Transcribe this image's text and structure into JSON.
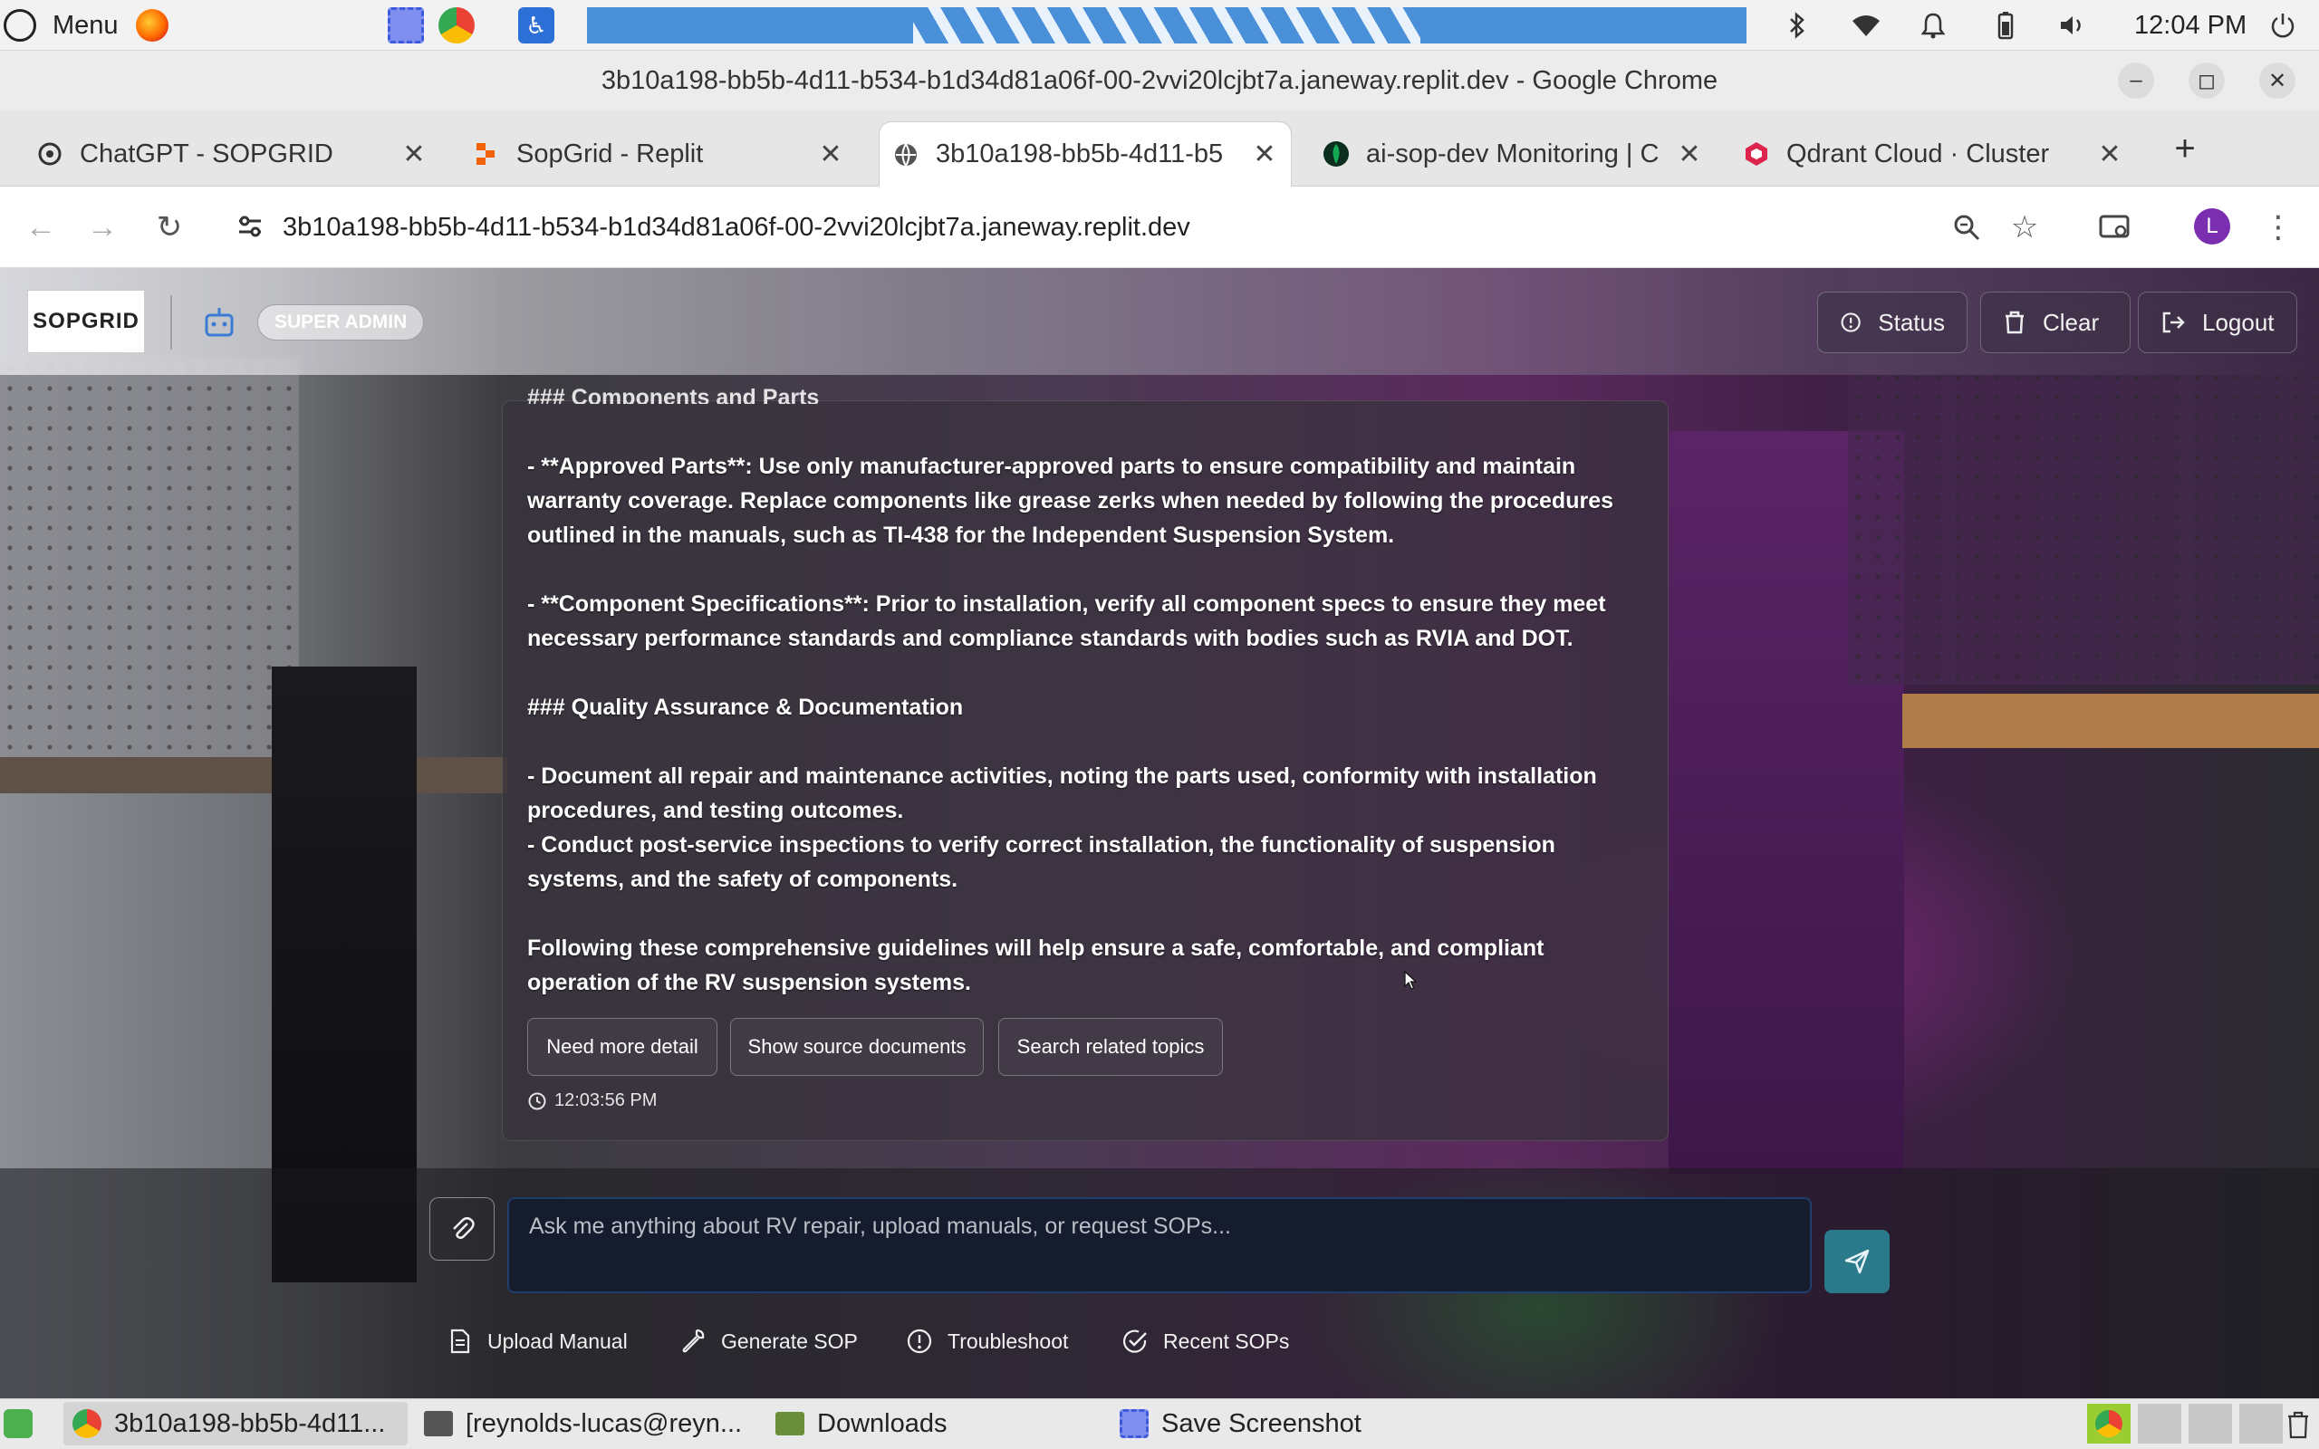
{
  "os_panel": {
    "menu_label": "Menu",
    "clock": "12:04 PM"
  },
  "browser": {
    "window_title": "3b10a198-bb5b-4d11-b534-b1d34d81a06f-00-2vvi20lcjbt7a.janeway.replit.dev - Google Chrome",
    "tabs": [
      {
        "label": "ChatGPT - SOPGRID",
        "active": false
      },
      {
        "label": "SopGrid - Replit",
        "active": false
      },
      {
        "label": "3b10a198-bb5b-4d11-b5",
        "active": true
      },
      {
        "label": "ai-sop-dev Monitoring | C",
        "active": false
      },
      {
        "label": "Qdrant Cloud · Cluster",
        "active": false
      }
    ],
    "new_tab": "+",
    "url": "3b10a198-bb5b-4d11-b534-b1d34d81a06f-00-2vvi20lcjbt7a.janeway.replit.dev",
    "profile_initial": "L"
  },
  "app": {
    "logo_text": "SOPGRID",
    "role_badge": "SUPER ADMIN",
    "header_buttons": {
      "status": "Status",
      "clear": "Clear",
      "logout": "Logout"
    },
    "message": {
      "partial_heading": "### Components and Parts",
      "approved_parts": "- **Approved Parts**: Use only manufacturer-approved parts to ensure compatibility and maintain warranty coverage. Replace components like grease zerks when needed by following the procedures outlined in the manuals, such as TI-438 for the Independent Suspension System.",
      "component_specs": "- **Component Specifications**: Prior to installation, verify all component specs to ensure they meet necessary performance standards and compliance standards with bodies such as RVIA and DOT.",
      "qa_heading": "### Quality Assurance & Documentation",
      "qa_line1": "- Document all repair and maintenance activities, noting the parts used, conformity with installation procedures, and testing outcomes.",
      "qa_line2": "- Conduct post-service inspections to verify correct installation, the functionality of suspension systems, and the safety of components.",
      "closing": "Following these comprehensive guidelines will help ensure a safe, comfortable, and compliant operation of the RV suspension systems.",
      "timestamp": "12:03:56 PM"
    },
    "followups": [
      "Need more detail",
      "Show source documents",
      "Search related topics"
    ],
    "input_placeholder": "Ask me anything about RV repair, upload manuals, or request SOPs...",
    "quick_actions": [
      "Upload Manual",
      "Generate SOP",
      "Troubleshoot",
      "Recent SOPs"
    ]
  },
  "taskbar": {
    "items": [
      "3b10a198-bb5b-4d11...",
      "[reynolds-lucas@reyn...",
      "Downloads",
      "Save Screenshot"
    ]
  },
  "colors": {
    "accent_send": "#2b7a8c",
    "input_bg": "#141c2e",
    "browser_blue": "#4a90d9",
    "profile_purple": "#7b2fb0"
  }
}
